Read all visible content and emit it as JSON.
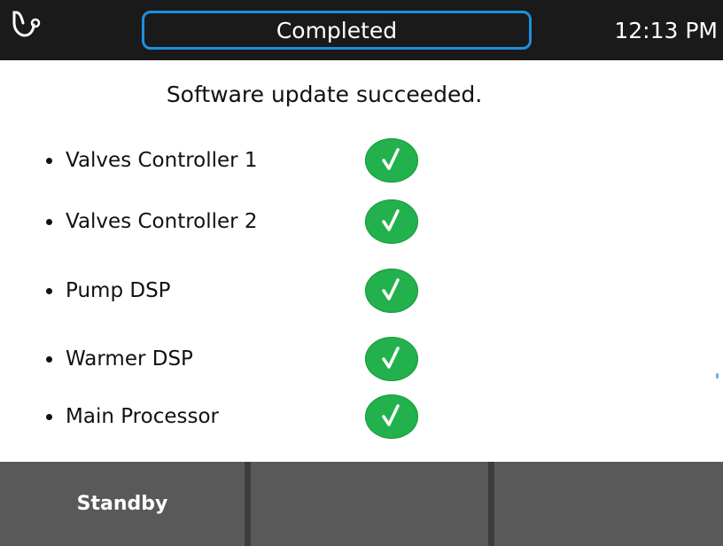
{
  "header": {
    "icon": "stethoscope-icon",
    "status": "Completed",
    "time": "12:13 PM",
    "status_border_color": "#1e8fe0"
  },
  "message": "Software update succeeded.",
  "components": [
    {
      "label": "Valves Controller 1",
      "status_icon": "check-icon",
      "status": "success"
    },
    {
      "label": "Valves Controller 2",
      "status_icon": "check-icon",
      "status": "success"
    },
    {
      "label": "Pump DSP",
      "status_icon": "check-icon",
      "status": "success"
    },
    {
      "label": "Warmer DSP",
      "status_icon": "check-icon",
      "status": "success"
    },
    {
      "label": "Main Processor",
      "status_icon": "check-icon",
      "status": "success"
    }
  ],
  "softkeys": [
    {
      "label": "Standby"
    },
    {
      "label": ""
    },
    {
      "label": ""
    }
  ],
  "colors": {
    "success": "#22b14c",
    "header_bg": "#1a1a1a",
    "softkey_bg": "#595959"
  }
}
